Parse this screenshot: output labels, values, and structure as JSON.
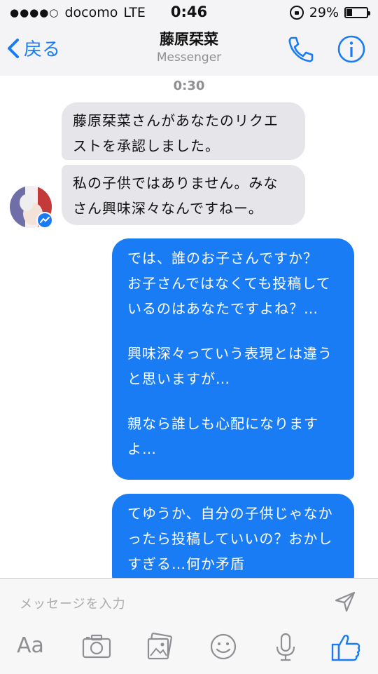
{
  "status_bar": {
    "signal_dots": "●●●●○",
    "carrier": "docomo",
    "network": "LTE",
    "time": "0:46",
    "battery_text": "29%",
    "battery_level": 0.29
  },
  "nav": {
    "back_label": "戻る",
    "title": "藤原栞菜",
    "subtitle": "Messenger"
  },
  "thread": {
    "timestamp": "0:30",
    "received": [
      {
        "lines": [
          "藤原栞菜さんがあなたのリクエ",
          "ストを承認しました。"
        ]
      },
      {
        "lines": [
          "私の子供ではありません。みな",
          "さん興味深々なんですねー。"
        ]
      }
    ],
    "sent": [
      {
        "paragraphs": [
          [
            "では、誰のお子さんですか？",
            "お子さんではなくても投稿して",
            "いるのはあなたですよね？…"
          ],
          [
            "興味深々っていう表現とは違う",
            "と思いますが…"
          ],
          [
            "親なら誰しも心配になります",
            "よ…"
          ]
        ]
      },
      {
        "paragraphs": [
          [
            "てゆうか、自分の子供じゃなか",
            "ったら投稿していいの？おかし",
            "すぎる…何か矛盾"
          ]
        ]
      }
    ]
  },
  "composer": {
    "placeholder": "メッセージを入力",
    "font_button": "Aa",
    "tools": [
      "camera-icon",
      "photo-gallery-icon",
      "emoji-icon",
      "microphone-icon",
      "like-icon"
    ]
  },
  "colors": {
    "accent": "#1a7cf5",
    "received_bubble": "#e5e5ea",
    "bar_background": "#f4f4f6"
  }
}
